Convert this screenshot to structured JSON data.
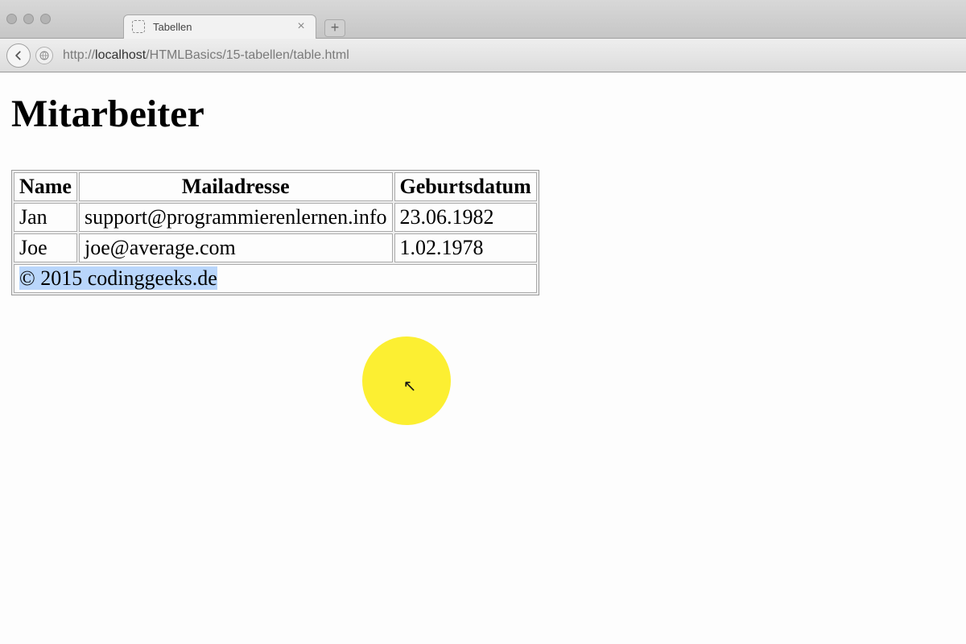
{
  "browser": {
    "tab_title": "Tabellen",
    "url_pre": "http://",
    "url_host": "localhost",
    "url_path": "/HTMLBasics/15-tabellen/table.html"
  },
  "page": {
    "heading": "Mitarbeiter",
    "columns": [
      "Name",
      "Mailadresse",
      "Geburtsdatum"
    ],
    "rows": [
      {
        "name": "Jan",
        "mail": "support@programmierenlernen.info",
        "dob": "23.06.1982"
      },
      {
        "name": "Joe",
        "mail": "joe@average.com",
        "dob": "1.02.1978"
      }
    ],
    "footer_text": "© 2015 codinggeeks.de"
  }
}
